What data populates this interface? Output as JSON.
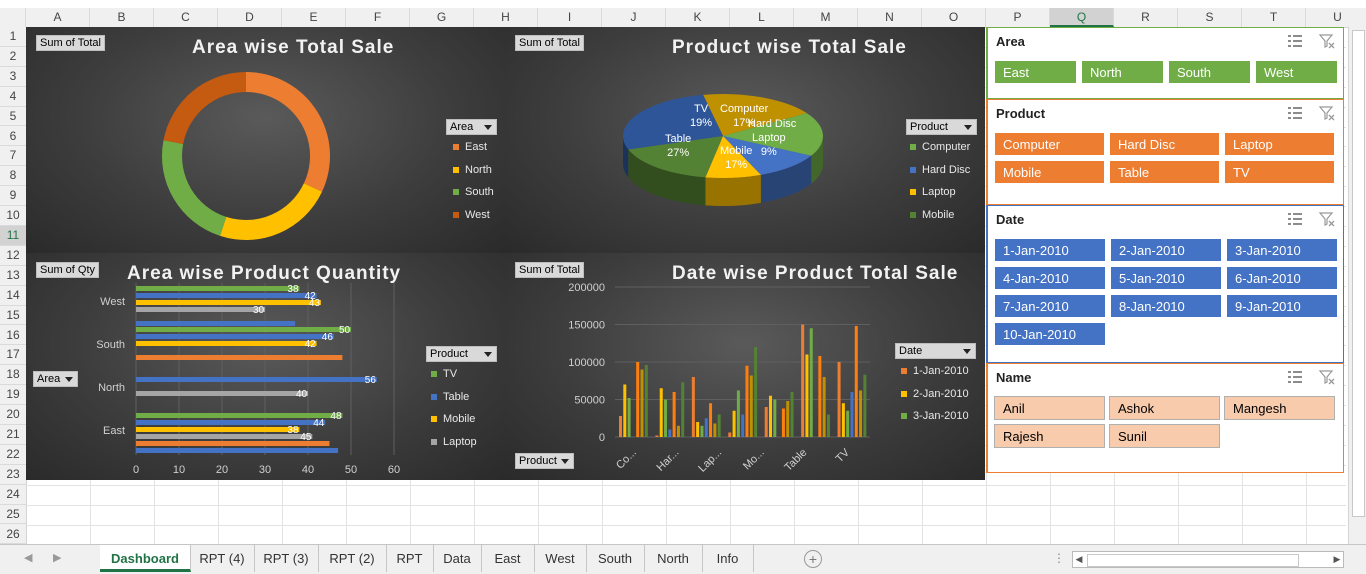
{
  "columns": [
    "A",
    "B",
    "C",
    "D",
    "E",
    "F",
    "G",
    "H",
    "I",
    "J",
    "K",
    "L",
    "M",
    "N",
    "O",
    "P",
    "Q",
    "R",
    "S",
    "T",
    "U"
  ],
  "rows": [
    "1",
    "2",
    "3",
    "4",
    "5",
    "6",
    "7",
    "8",
    "9",
    "10",
    "11",
    "12",
    "13",
    "14",
    "15",
    "16",
    "17",
    "18",
    "19",
    "20",
    "21",
    "22",
    "23",
    "24",
    "25",
    "26"
  ],
  "selected_column": "Q",
  "selected_row": "11",
  "dashboard": {
    "area_total": {
      "field_button": "Sum of Total",
      "title": "Area wise Total Sale",
      "filter_label": "Area",
      "legend": [
        {
          "name": "East",
          "color": "#ed7d31"
        },
        {
          "name": "North",
          "color": "#ffc000"
        },
        {
          "name": "South",
          "color": "#70ad47"
        },
        {
          "name": "West",
          "color": "#c55a11"
        }
      ]
    },
    "product_total": {
      "field_button": "Sum of Total",
      "title": "Product wise Total Sale",
      "filter_label": "Product",
      "legend": [
        {
          "name": "Computer",
          "color": "#70ad47"
        },
        {
          "name": "Hard Disc",
          "color": "#4472c4"
        },
        {
          "name": "Laptop",
          "color": "#ffc000"
        },
        {
          "name": "Mobile",
          "color": "#548235"
        }
      ],
      "slice_labels": [
        {
          "name": "TV",
          "pct": "19%"
        },
        {
          "name": "Computer",
          "pct": "17%"
        },
        {
          "name": "Hard Disc",
          "pct": ""
        },
        {
          "name": "Laptop",
          "pct": "9%"
        },
        {
          "name": "Table",
          "pct": "27%"
        },
        {
          "name": "Mobile",
          "pct": "17%"
        }
      ]
    },
    "area_qty": {
      "field_button": "Sum of Qty",
      "title": "Area wise Product Quantity",
      "row_button": "Area",
      "filter_label": "Product",
      "legend": [
        {
          "name": "TV",
          "color": "#70ad47"
        },
        {
          "name": "Table",
          "color": "#4472c4"
        },
        {
          "name": "Mobile",
          "color": "#ffc000"
        },
        {
          "name": "Laptop",
          "color": "#a5a5a5"
        }
      ]
    },
    "date_total": {
      "field_button": "Sum of Total",
      "title": "Date wise Product Total Sale",
      "row_button": "Product",
      "filter_label": "Date",
      "legend": [
        {
          "name": "1-Jan-2010",
          "color": "#ed7d31"
        },
        {
          "name": "2-Jan-2010",
          "color": "#ffc000"
        },
        {
          "name": "3-Jan-2010",
          "color": "#70ad47"
        }
      ]
    }
  },
  "chart_data": [
    {
      "type": "pie",
      "title": "Area wise Total Sale",
      "categories": [
        "East",
        "North",
        "South",
        "West"
      ],
      "values": [
        32,
        23,
        23,
        22
      ]
    },
    {
      "type": "pie",
      "title": "Product wise Total Sale",
      "categories": [
        "Computer",
        "Hard Disc",
        "Laptop",
        "Mobile",
        "Table",
        "TV"
      ],
      "values": [
        17,
        11,
        9,
        17,
        27,
        19
      ],
      "labels_shown": [
        "19%",
        "17%",
        "9%",
        "27%",
        "17%"
      ]
    },
    {
      "type": "bar",
      "title": "Area wise Product Quantity",
      "categories": [
        "East",
        "North",
        "South",
        "West"
      ],
      "xlim": [
        0,
        60
      ],
      "xticks": [
        "0",
        "10",
        "20",
        "30",
        "40",
        "50",
        "60"
      ],
      "series": [
        {
          "name": "TV",
          "color": "#70ad47",
          "values": [
            48,
            0,
            50,
            38
          ]
        },
        {
          "name": "Table",
          "color": "#4472c4",
          "values": [
            44,
            56,
            46,
            42
          ]
        },
        {
          "name": "Mobile",
          "color": "#ffc000",
          "values": [
            38,
            0,
            42,
            43
          ]
        },
        {
          "name": "Laptop",
          "color": "#a5a5a5",
          "values": [
            41,
            40,
            0,
            30
          ]
        },
        {
          "name": "",
          "color": "#ed7d31",
          "values": [
            45,
            0,
            48,
            0
          ]
        },
        {
          "name": "",
          "color": "#4472c4",
          "values": [
            47,
            0,
            0,
            37
          ]
        }
      ],
      "data_labels": {
        "East": [
          "48",
          "44",
          "38",
          "45"
        ],
        "North": [
          "56",
          "40"
        ],
        "South": [
          "50",
          "46",
          "42",
          "48"
        ],
        "West": [
          "38",
          "42",
          "43",
          "30"
        ]
      }
    },
    {
      "type": "bar",
      "title": "Date wise Product Total Sale",
      "categories": [
        "Co...",
        "Har...",
        "Lap...",
        "Mo...",
        "Table",
        "TV"
      ],
      "ylim": [
        0,
        200000
      ],
      "yticks": [
        "0",
        "50000",
        "100000",
        "150000",
        "200000"
      ],
      "series": [
        {
          "name": "1-Jan-2010",
          "color": "#ed7d31",
          "values": [
            28000,
            2000,
            80000,
            6000,
            40000,
            150000,
            100000
          ]
        },
        {
          "name": "2-Jan-2010",
          "color": "#ffc000",
          "values": [
            70000,
            65000,
            20000,
            35000,
            55000,
            110000,
            45000
          ]
        },
        {
          "name": "3-Jan-2010",
          "color": "#70ad47",
          "values": [
            52000,
            50000,
            15000,
            62000,
            50000,
            145000,
            35000
          ]
        },
        {
          "name": "",
          "color": "#4472c4",
          "values": [
            0,
            10000,
            25000,
            30000,
            0,
            0,
            60000
          ]
        },
        {
          "name": "",
          "color": "#ff7f0e",
          "values": [
            100000,
            60000,
            45000,
            95000,
            38000,
            108000,
            148000
          ]
        },
        {
          "name": "",
          "color": "#bf9000",
          "values": [
            90000,
            15000,
            18000,
            82000,
            48000,
            80000,
            62000
          ]
        },
        {
          "name": "",
          "color": "#548235",
          "values": [
            96000,
            73000,
            30000,
            120000,
            60000,
            30000,
            83000
          ]
        }
      ]
    }
  ],
  "slicers": {
    "area": {
      "title": "Area",
      "items": [
        "East",
        "North",
        "South",
        "West"
      ]
    },
    "product": {
      "title": "Product",
      "items": [
        "Computer",
        "Hard Disc",
        "Laptop",
        "Mobile",
        "Table",
        "TV"
      ]
    },
    "date": {
      "title": "Date",
      "items": [
        "1-Jan-2010",
        "2-Jan-2010",
        "3-Jan-2010",
        "4-Jan-2010",
        "5-Jan-2010",
        "6-Jan-2010",
        "7-Jan-2010",
        "8-Jan-2010",
        "9-Jan-2010",
        "10-Jan-2010"
      ]
    },
    "name": {
      "title": "Name",
      "items": [
        "Anil",
        "Ashok",
        "Mangesh",
        "Rajesh",
        "Sunil"
      ]
    }
  },
  "sheet_tabs": [
    "Dashboard",
    "RPT (4)",
    "RPT (3)",
    "RPT (2)",
    "RPT",
    "Data",
    "East",
    "West",
    "South",
    "North",
    "Info"
  ],
  "active_tab": "Dashboard"
}
